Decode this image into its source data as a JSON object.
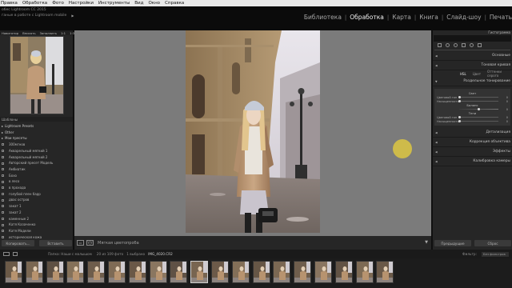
{
  "menu": [
    "Правка",
    "Обработка",
    "Фото",
    "Настройки",
    "Инструменты",
    "Вид",
    "Окно",
    "Справка"
  ],
  "identity": {
    "line1": "обес Lightroom CC 2015",
    "line2": "ганые в работе с Lightroom mobile"
  },
  "modules": [
    {
      "label": "Библиотека",
      "active": false
    },
    {
      "label": "Обработка",
      "active": true
    },
    {
      "label": "Карта",
      "active": false
    },
    {
      "label": "Книга",
      "active": false
    },
    {
      "label": "Слайд-шоу",
      "active": false
    },
    {
      "label": "Печать",
      "active": false
    }
  ],
  "left_panel": {
    "nav_header": [
      "Навигатор",
      "Вписать",
      "Заполнить",
      "1:1",
      "1:3"
    ],
    "presets_header": "Шаблоны",
    "presets": [
      {
        "label": "Lightroom Presets",
        "group": true
      },
      {
        "label": "Other",
        "group": true
      },
      {
        "label": "Мои пресеты",
        "group": true
      },
      {
        "label": "300мгнов",
        "group": false
      },
      {
        "label": "Акварельный мягкий 1",
        "group": false
      },
      {
        "label": "Акварельный мягкий 2",
        "group": false
      },
      {
        "label": "Авторский пресет Модель",
        "group": false
      },
      {
        "label": "Амбиатик",
        "group": false
      },
      {
        "label": "Бохо",
        "group": false
      },
      {
        "label": "в лесо",
        "group": false
      },
      {
        "label": "в прохода",
        "group": false
      },
      {
        "label": "голубой плен барр",
        "group": false
      },
      {
        "label": "двас остров",
        "group": false
      },
      {
        "label": "закат 1",
        "group": false
      },
      {
        "label": "закат 2",
        "group": false
      },
      {
        "label": "каменные 2",
        "group": false
      },
      {
        "label": "Катя Казаченко",
        "group": false
      },
      {
        "label": "Катя Модели",
        "group": false
      },
      {
        "label": "историческая кожа",
        "group": false
      }
    ],
    "copy_button": "Копировать...",
    "paste_button": "Вставить"
  },
  "toolbar": {
    "preview_label": "Мягкая цветопроба"
  },
  "right_panel": {
    "histogram_label": "Гистограмма",
    "sections": [
      {
        "label": "Основные",
        "id": "basic"
      },
      {
        "label": "Тоновая кривая",
        "id": "tone"
      }
    ],
    "hsl_tabs": [
      "HSL",
      "Цвет",
      "Оттенки серого"
    ],
    "split_toning": {
      "title": "Раздельное тонирование",
      "highlights_label": "Свет",
      "shadows_label": "Тени",
      "balance_label": "Баланс",
      "hue_label": "Цветовой тон",
      "sat_label": "Насыщенность",
      "highlights_hue": 0,
      "highlights_sat": 0,
      "balance": 0,
      "shadows_hue": 0,
      "shadows_sat": 0
    },
    "sections_bottom": [
      {
        "label": "Детализация",
        "id": "detail"
      },
      {
        "label": "Коррекция объектива",
        "id": "lens"
      },
      {
        "label": "Эффекты",
        "id": "effects"
      },
      {
        "label": "Калибровка камеры",
        "id": "calibration"
      }
    ],
    "previous_button": "Предыдущие",
    "reset_button": "Сброс"
  },
  "filmstrip_bar": {
    "path_text": "Папка: Наши с малышом",
    "count_text": "20 из 109 фото",
    "selected_text": "1 выбрано",
    "filename": "IMG_4020.CR2",
    "filter_label": "Фильтр:",
    "filter_value": "Без фильтров"
  },
  "colors": {
    "cursor_highlight": "#e6cd3c",
    "panel_bg": "#262626",
    "canvas_bg": "#7b7b7b"
  }
}
